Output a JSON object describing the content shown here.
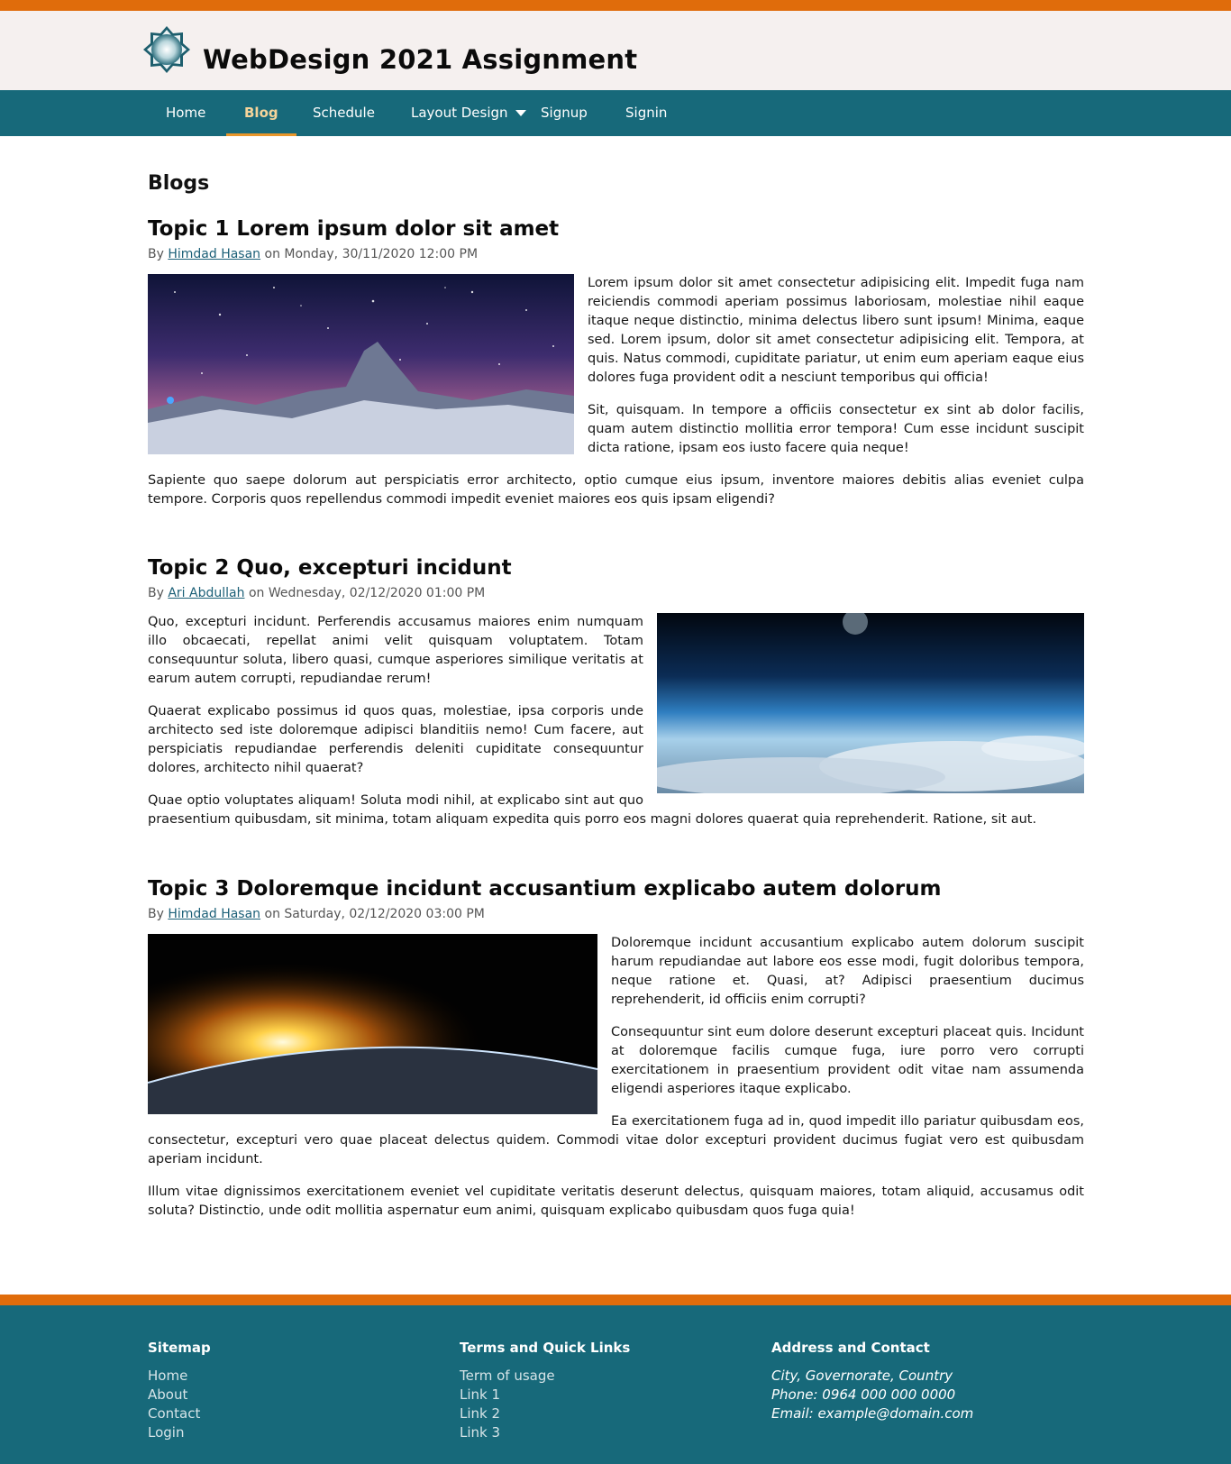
{
  "site": {
    "title": "WebDesign 2021 Assignment"
  },
  "nav": {
    "items": [
      {
        "label": "Home"
      },
      {
        "label": "Blog"
      },
      {
        "label": "Schedule"
      },
      {
        "label": "Layout Design"
      },
      {
        "label": "Signup"
      },
      {
        "label": "Signin"
      }
    ],
    "active": "Blog"
  },
  "page": {
    "heading": "Blogs"
  },
  "posts": [
    {
      "title": "Topic 1 Lorem ipsum dolor sit amet",
      "by": "By",
      "author": "Himdad Hasan",
      "on": "on Monday, 30/11/2020 12:00 PM",
      "paragraphs": [
        "Lorem ipsum dolor sit amet consectetur adipisicing elit. Impedit fuga nam reiciendis commodi aperiam possimus laboriosam, molestiae nihil eaque itaque neque distinctio, minima delectus libero sunt ipsum! Minima, eaque sed. Lorem ipsum, dolor sit amet consectetur adipisicing elit. Tempora, at quis. Natus commodi, cupiditate pariatur, ut enim eum aperiam eaque eius dolores fuga provident odit a nesciunt temporibus qui officia!",
        "Sit, quisquam. In tempore a officiis consectetur ex sint ab dolor facilis, quam autem distinctio mollitia error tempora! Cum esse incidunt suscipit dicta ratione, ipsam eos iusto facere quia neque!",
        "Sapiente quo saepe dolorum aut perspiciatis error architecto, optio cumque eius ipsum, inventore maiores debitis alias eveniet culpa tempore. Corporis quos repellendus commodi impedit eveniet maiores eos quis ipsam eligendi?"
      ]
    },
    {
      "title": "Topic 2 Quo, excepturi incidunt",
      "by": "By",
      "author": "Ari Abdullah",
      "on": "on Wednesday, 02/12/2020 01:00 PM",
      "paragraphs": [
        "Quo, excepturi incidunt. Perferendis accusamus maiores enim numquam illo obcaecati, repellat animi velit quisquam voluptatem. Totam consequuntur soluta, libero quasi, cumque asperiores similique veritatis at earum autem corrupti, repudiandae rerum!",
        "Quaerat explicabo possimus id quos quas, molestiae, ipsa corporis unde architecto sed iste doloremque adipisci blanditiis nemo! Cum facere, aut perspiciatis repudiandae perferendis deleniti cupiditate consequuntur dolores, architecto nihil quaerat?",
        "Quae optio voluptates aliquam! Soluta modi nihil, at explicabo sint aut quo praesentium quibusdam, sit minima, totam aliquam expedita quis porro eos magni dolores quaerat quia reprehenderit. Ratione, sit aut."
      ]
    },
    {
      "title": "Topic 3 Doloremque incidunt accusantium explicabo autem dolorum",
      "by": "By",
      "author": "Himdad Hasan",
      "on": "on Saturday, 02/12/2020 03:00 PM",
      "paragraphs": [
        "Doloremque incidunt accusantium explicabo autem dolorum suscipit harum repudiandae aut labore eos esse modi, fugit doloribus tempora, neque ratione et. Quasi, at? Adipisci praesentium ducimus reprehenderit, id officiis enim corrupti?",
        "Consequuntur sint eum dolore deserunt excepturi placeat quis. Incidunt at doloremque facilis cumque fuga, iure porro vero corrupti exercitationem in praesentium provident odit vitae nam assumenda eligendi asperiores itaque explicabo.",
        "Ea exercitationem fuga ad in, quod impedit illo pariatur quibusdam eos, consectetur, excepturi vero quae placeat delectus quidem. Commodi vitae dolor excepturi provident ducimus fugiat vero est quibusdam aperiam incidunt.",
        "Illum vitae dignissimos exercitationem eveniet vel cupiditate veritatis deserunt delectus, quisquam maiores, totam aliquid, accusamus odit soluta? Distinctio, unde odit mollitia aspernatur eum animi, quisquam explicabo quibusdam quos fuga quia!"
      ]
    }
  ],
  "footer": {
    "sitemap": {
      "heading": "Sitemap",
      "links": [
        "Home",
        "About",
        "Contact",
        "Login"
      ]
    },
    "terms": {
      "heading": "Terms and Quick Links",
      "links": [
        "Term of usage",
        "Link 1",
        "Link 2",
        "Link 3"
      ]
    },
    "contact": {
      "heading": "Address and Contact",
      "lines": [
        "City, Governorate, Country",
        "Phone: 0964 000 000 0000",
        "Email: example@domain.com"
      ]
    }
  },
  "colors": {
    "accent": "#e06c0b",
    "nav": "#17697a",
    "header_bg": "#f5f0ef",
    "active_nav": "#f5d49a"
  }
}
